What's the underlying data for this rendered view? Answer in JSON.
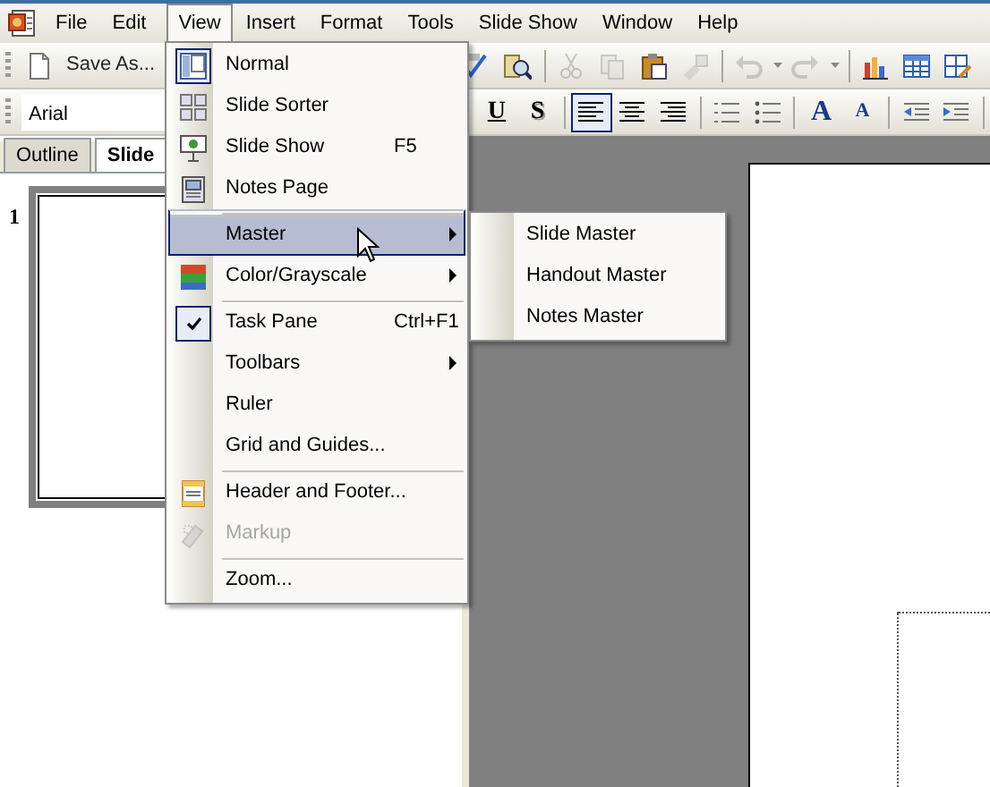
{
  "menubar": [
    {
      "label": "File",
      "selected": false
    },
    {
      "label": "Edit",
      "selected": false
    },
    {
      "label": "View",
      "selected": true
    },
    {
      "label": "Insert",
      "selected": false
    },
    {
      "label": "Format",
      "selected": false
    },
    {
      "label": "Tools",
      "selected": false
    },
    {
      "label": "Slide Show",
      "selected": false
    },
    {
      "label": "Window",
      "selected": false
    },
    {
      "label": "Help",
      "selected": false
    }
  ],
  "standard_toolbar": {
    "save_as": "Save As...",
    "buttons": [
      {
        "disabled": false
      },
      {
        "disabled": false
      },
      {
        "disabled": true
      },
      {
        "disabled": true
      },
      {
        "disabled": false
      },
      {
        "disabled": true
      },
      {
        "disabled": true
      },
      {
        "disabled": true
      },
      {
        "disabled": false
      },
      {
        "disabled": false
      },
      {
        "disabled": false
      }
    ]
  },
  "formatting_toolbar": {
    "font": "Arial",
    "buttons": [
      {
        "label": "U",
        "selected": false
      },
      {
        "label": "S",
        "selected": false
      },
      {
        "selected": true
      },
      {
        "selected": false
      },
      {
        "selected": false
      },
      {
        "selected": false
      },
      {
        "selected": false
      },
      {
        "label": "A",
        "selected": false
      },
      {
        "label": "A",
        "selected": false
      },
      {
        "selected": false
      },
      {
        "selected": false
      }
    ]
  },
  "pane_tabs": [
    {
      "label": "Outline",
      "selected": false
    },
    {
      "label": "Slide",
      "selected": true
    }
  ],
  "slide_number": "1",
  "view_menu": [
    {
      "label": "Normal",
      "checked": true,
      "disabled": false,
      "selected": false,
      "submenu": false,
      "separator_before": false
    },
    {
      "label": "Slide Sorter",
      "checked": false,
      "disabled": false,
      "selected": false,
      "submenu": false,
      "separator_before": false
    },
    {
      "label": "Slide Show",
      "shortcut": "F5",
      "checked": false,
      "disabled": false,
      "selected": false,
      "submenu": false,
      "separator_before": false
    },
    {
      "label": "Notes Page",
      "checked": false,
      "disabled": false,
      "selected": false,
      "submenu": false,
      "separator_before": false
    },
    {
      "label": "Master",
      "checked": false,
      "disabled": false,
      "selected": true,
      "submenu": true,
      "separator_before": true
    },
    {
      "label": "Color/Grayscale",
      "checked": false,
      "disabled": false,
      "selected": false,
      "submenu": true,
      "separator_before": false
    },
    {
      "label": "Task Pane",
      "shortcut": "Ctrl+F1",
      "checked": true,
      "disabled": false,
      "selected": false,
      "submenu": false,
      "separator_before": true
    },
    {
      "label": "Toolbars",
      "checked": false,
      "disabled": false,
      "selected": false,
      "submenu": true,
      "separator_before": false
    },
    {
      "label": "Ruler",
      "checked": false,
      "disabled": false,
      "selected": false,
      "submenu": false,
      "separator_before": false
    },
    {
      "label": "Grid and Guides...",
      "checked": false,
      "disabled": false,
      "selected": false,
      "submenu": false,
      "separator_before": false
    },
    {
      "label": "Header and Footer...",
      "checked": false,
      "disabled": false,
      "selected": false,
      "submenu": false,
      "separator_before": true
    },
    {
      "label": "Markup",
      "checked": false,
      "disabled": true,
      "selected": false,
      "submenu": false,
      "separator_before": false
    },
    {
      "label": "Zoom...",
      "checked": false,
      "disabled": false,
      "selected": false,
      "submenu": false,
      "separator_before": true
    }
  ],
  "master_submenu": [
    {
      "label": "Slide Master"
    },
    {
      "label": "Handout Master"
    },
    {
      "label": "Notes Master"
    }
  ]
}
